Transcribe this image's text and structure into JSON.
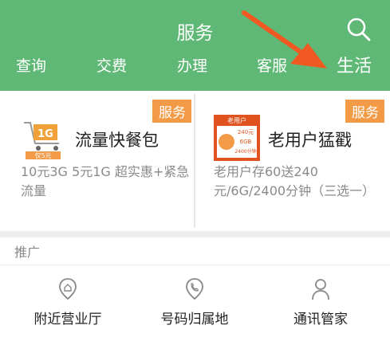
{
  "header": {
    "title": "服务",
    "tabs": [
      "查询",
      "交费",
      "办理",
      "客服",
      "生活"
    ],
    "active_tab": "生活"
  },
  "cards": [
    {
      "badge": "服务",
      "title": "流量快餐包",
      "desc": "10元3G 5元1G 超实惠+紧急流量",
      "thumb": {
        "line1": "1G",
        "line2": "仅5元"
      }
    },
    {
      "badge": "服务",
      "title": "老用户猛戳",
      "desc": "老用户存60送240元/6G/2400分钟（三选一）",
      "thumb": {
        "line1": "老用户",
        "line2": "240元",
        "line3": "6GB",
        "line4": "2400分钟"
      }
    }
  ],
  "section": {
    "label": "推广"
  },
  "services": [
    {
      "label": "附近营业厅",
      "icon": "location-pin-icon"
    },
    {
      "label": "号码归属地",
      "icon": "phone-location-icon"
    },
    {
      "label": "通讯管家",
      "icon": "person-icon"
    }
  ],
  "colors": {
    "header_bg": "#5fb875",
    "badge_bg": "#f29a45",
    "arrow": "#f05a22"
  }
}
